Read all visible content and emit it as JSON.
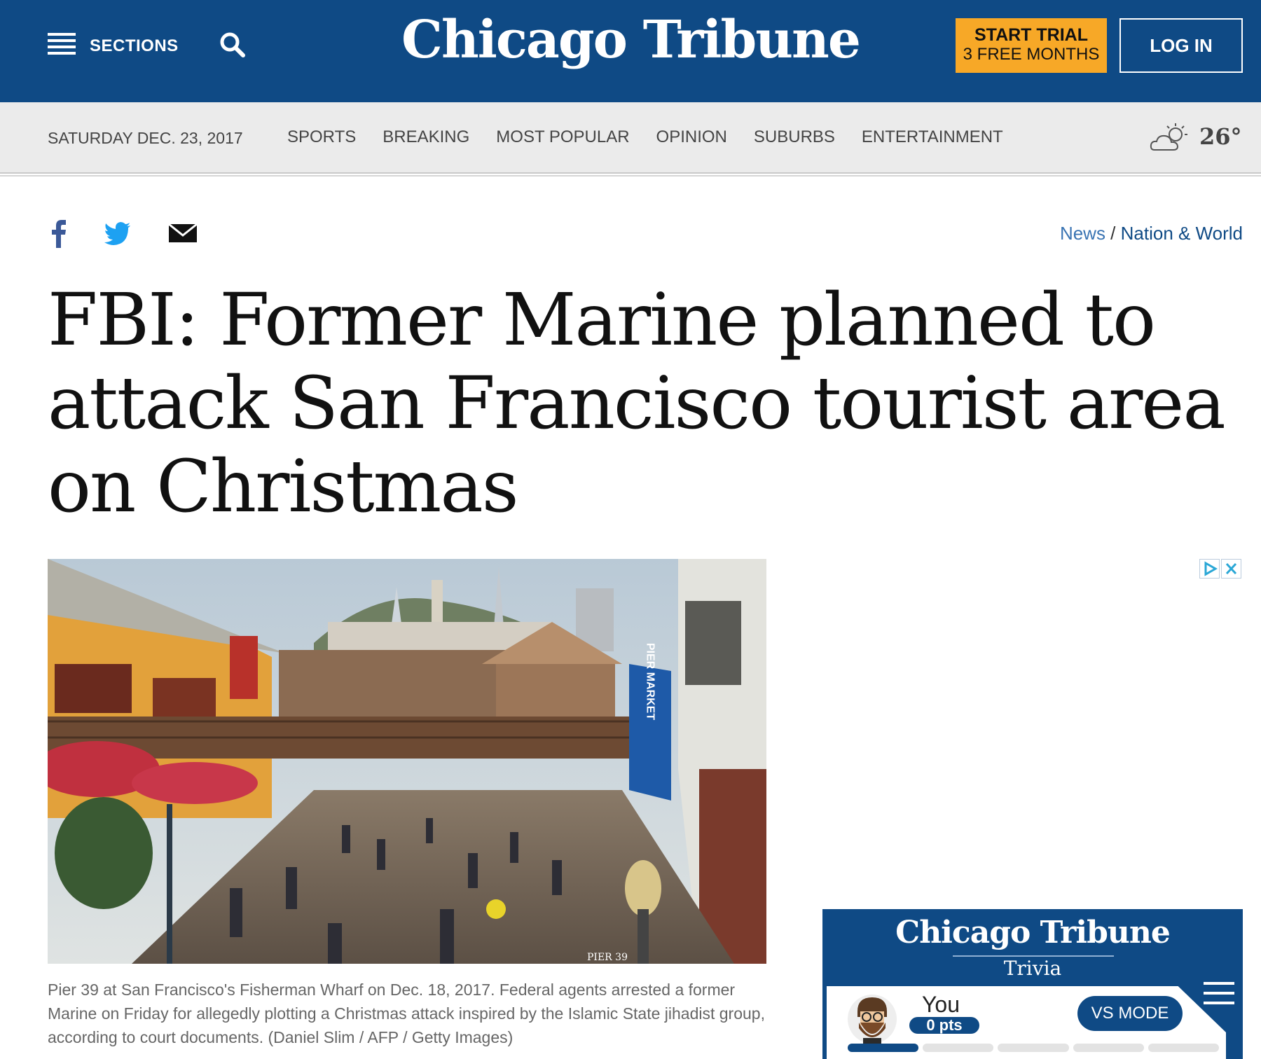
{
  "header": {
    "sections_label": "SECTIONS",
    "logo_text": "Chicago Tribune",
    "trial_line1": "START TRIAL",
    "trial_line2": "3 FREE MONTHS",
    "login_label": "LOG IN",
    "brand_blue": "#0f4a85",
    "trial_orange": "#f7a827"
  },
  "nav": {
    "date": "SATURDAY DEC. 23, 2017",
    "links": [
      "SPORTS",
      "BREAKING",
      "MOST POPULAR",
      "OPINION",
      "SUBURBS",
      "ENTERTAINMENT"
    ],
    "temperature": "26°",
    "weather_icon": "partly-cloudy-icon"
  },
  "share": {
    "icons": [
      "facebook-icon",
      "twitter-icon",
      "email-icon"
    ]
  },
  "breadcrumb": {
    "news": "News",
    "separator": " / ",
    "section": "Nation & World"
  },
  "article": {
    "headline": "FBI: Former Marine planned to attack San Francisco tourist area on Christmas",
    "caption": "Pier 39 at San Francisco's Fisherman Wharf on Dec. 18, 2017. Federal agents arrested a former Marine on Friday for allegedly plotting a Christmas attack inspired by the Islamic State jihadist group, according to court documents. (Daniel Slim / AFP / Getty Images)",
    "photo_sign_text": "PIER MARKET",
    "photo_pier_text": "PIER 39"
  },
  "trivia": {
    "logo_text": "Chicago Tribune",
    "subtitle": "Trivia",
    "you_label": "You",
    "points": "0 pts",
    "vs_mode": "VS MODE"
  }
}
